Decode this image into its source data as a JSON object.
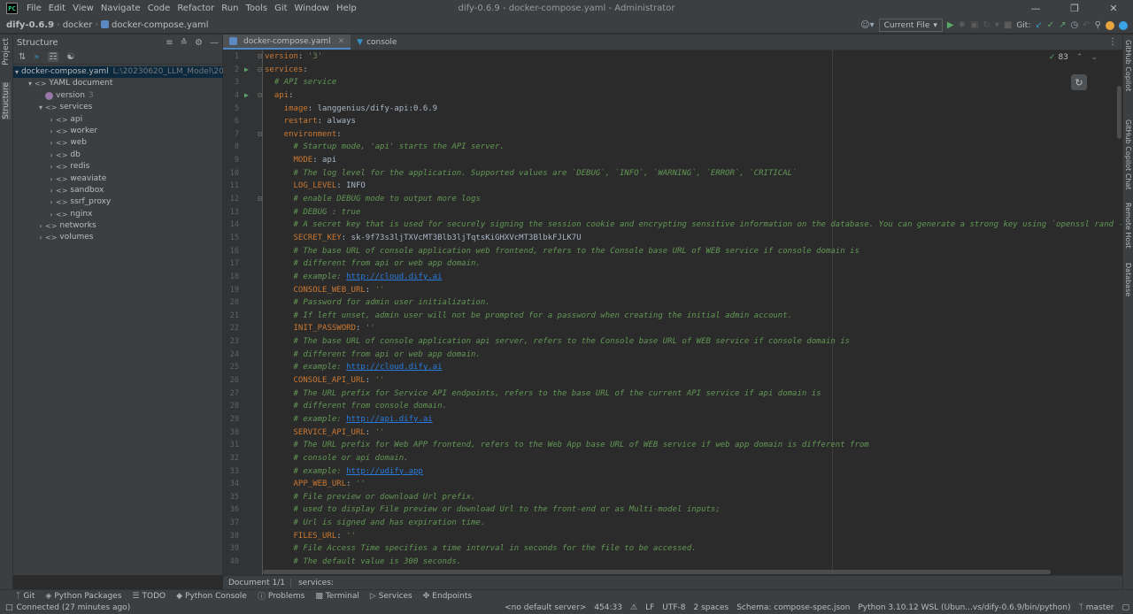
{
  "titlebar": {
    "menu": [
      "File",
      "Edit",
      "View",
      "Navigate",
      "Code",
      "Refactor",
      "Run",
      "Tools",
      "Git",
      "Window",
      "Help"
    ],
    "title": "dify-0.6.9 - docker-compose.yaml - Administrator"
  },
  "navbar": {
    "project": "dify-0.6.9",
    "folder": "docker",
    "file": "docker-compose.yaml",
    "run_config": "Current File",
    "git_label": "Git:"
  },
  "left_stripe": {
    "project_tab": "Project",
    "structure_tab": "Structure"
  },
  "structure": {
    "title": "Structure",
    "tree": [
      {
        "label": "docker-compose.yaml",
        "path": "L:\\20230620_LLM_Model\\2023"
      },
      {
        "label": "YAML document"
      },
      {
        "label": "version",
        "count": "3"
      },
      {
        "label": "services"
      },
      {
        "label": "api"
      },
      {
        "label": "worker"
      },
      {
        "label": "web"
      },
      {
        "label": "db"
      },
      {
        "label": "redis"
      },
      {
        "label": "weaviate"
      },
      {
        "label": "sandbox"
      },
      {
        "label": "ssrf_proxy"
      },
      {
        "label": "nginx"
      },
      {
        "label": "networks"
      },
      {
        "label": "volumes"
      }
    ]
  },
  "tabs": [
    {
      "label": "docker-compose.yaml"
    },
    {
      "label": "console"
    }
  ],
  "editor": {
    "inspection_count": "83",
    "lines": [
      {
        "n": "1",
        "parts": [
          [
            "k",
            "version"
          ],
          [
            "v",
            ": "
          ],
          [
            "s",
            "'3'"
          ]
        ]
      },
      {
        "n": "2",
        "parts": [
          [
            "k",
            "services"
          ],
          [
            "v",
            ":"
          ]
        ]
      },
      {
        "n": "3",
        "parts": [
          [
            "c",
            "  # API service"
          ]
        ]
      },
      {
        "n": "4",
        "parts": [
          [
            "v",
            "  "
          ],
          [
            "k",
            "api"
          ],
          [
            "v",
            ":"
          ]
        ]
      },
      {
        "n": "5",
        "parts": [
          [
            "v",
            "    "
          ],
          [
            "k",
            "image"
          ],
          [
            "v",
            ": langgenius/dify-api:0.6.9"
          ]
        ]
      },
      {
        "n": "6",
        "parts": [
          [
            "v",
            "    "
          ],
          [
            "k",
            "restart"
          ],
          [
            "v",
            ": always"
          ]
        ]
      },
      {
        "n": "7",
        "parts": [
          [
            "v",
            "    "
          ],
          [
            "k",
            "environment"
          ],
          [
            "v",
            ":"
          ]
        ]
      },
      {
        "n": "8",
        "parts": [
          [
            "c",
            "      # Startup mode, 'api' starts the API server."
          ]
        ]
      },
      {
        "n": "9",
        "parts": [
          [
            "v",
            "      "
          ],
          [
            "k",
            "MODE"
          ],
          [
            "v",
            ": api"
          ]
        ]
      },
      {
        "n": "10",
        "parts": [
          [
            "c",
            "      # The log level for the application. Supported values are `DEBUG`, `INFO`, `WARNING`, `ERROR`, `CRITICAL`"
          ]
        ]
      },
      {
        "n": "11",
        "parts": [
          [
            "v",
            "      "
          ],
          [
            "k",
            "LOG_LEVEL"
          ],
          [
            "v",
            ": INFO"
          ]
        ]
      },
      {
        "n": "12",
        "parts": [
          [
            "c",
            "      # enable DEBUG mode to output more logs"
          ]
        ]
      },
      {
        "n": "13",
        "parts": [
          [
            "c",
            "      # DEBUG : true"
          ]
        ]
      },
      {
        "n": "14",
        "parts": [
          [
            "c",
            "      # A secret key that is used for securely signing the session cookie and encrypting sensitive information on the database. You can generate a strong key using `openssl rand -ba"
          ]
        ]
      },
      {
        "n": "15",
        "parts": [
          [
            "v",
            "      "
          ],
          [
            "k",
            "SECRET_KEY"
          ],
          [
            "v",
            ": sk-9f73s3ljTXVcMT3Blb3ljTqtsKiGHXVcMT3BlbkFJLK7U"
          ]
        ]
      },
      {
        "n": "16",
        "parts": [
          [
            "c",
            "      # The base URL of console application web frontend, refers to the Console base URL of WEB service if console domain is"
          ]
        ]
      },
      {
        "n": "17",
        "parts": [
          [
            "c",
            "      # different from api or web app domain."
          ]
        ]
      },
      {
        "n": "18",
        "parts": [
          [
            "c",
            "      # example: "
          ],
          [
            "u",
            "http://cloud.dify.ai"
          ]
        ]
      },
      {
        "n": "19",
        "parts": [
          [
            "v",
            "      "
          ],
          [
            "k",
            "CONSOLE_WEB_URL"
          ],
          [
            "v",
            ": "
          ],
          [
            "s",
            "''"
          ]
        ]
      },
      {
        "n": "20",
        "parts": [
          [
            "c",
            "      # Password for admin user initialization."
          ]
        ]
      },
      {
        "n": "21",
        "parts": [
          [
            "c",
            "      # If left unset, admin user will not be prompted for a password when creating the initial admin account."
          ]
        ]
      },
      {
        "n": "22",
        "parts": [
          [
            "v",
            "      "
          ],
          [
            "k",
            "INIT_PASSWORD"
          ],
          [
            "v",
            ": "
          ],
          [
            "s",
            "''"
          ]
        ]
      },
      {
        "n": "23",
        "parts": [
          [
            "c",
            "      # The base URL of console application api server, refers to the Console base URL of WEB service if console domain is"
          ]
        ]
      },
      {
        "n": "24",
        "parts": [
          [
            "c",
            "      # different from api or web app domain."
          ]
        ]
      },
      {
        "n": "25",
        "parts": [
          [
            "c",
            "      # example: "
          ],
          [
            "u",
            "http://cloud.dify.ai"
          ]
        ]
      },
      {
        "n": "26",
        "parts": [
          [
            "v",
            "      "
          ],
          [
            "k",
            "CONSOLE_API_URL"
          ],
          [
            "v",
            ": "
          ],
          [
            "s",
            "''"
          ]
        ]
      },
      {
        "n": "27",
        "parts": [
          [
            "c",
            "      # The URL prefix for Service API endpoints, refers to the base URL of the current API service if api domain is"
          ]
        ]
      },
      {
        "n": "28",
        "parts": [
          [
            "c",
            "      # different from console domain."
          ]
        ]
      },
      {
        "n": "29",
        "parts": [
          [
            "c",
            "      # example: "
          ],
          [
            "u",
            "http://api.dify.ai"
          ]
        ]
      },
      {
        "n": "30",
        "parts": [
          [
            "v",
            "      "
          ],
          [
            "k",
            "SERVICE_API_URL"
          ],
          [
            "v",
            ": "
          ],
          [
            "s",
            "''"
          ]
        ]
      },
      {
        "n": "31",
        "parts": [
          [
            "c",
            "      # The URL prefix for Web APP frontend, refers to the Web App base URL of WEB service if web app domain is different from"
          ]
        ]
      },
      {
        "n": "32",
        "parts": [
          [
            "c",
            "      # console or api domain."
          ]
        ]
      },
      {
        "n": "33",
        "parts": [
          [
            "c",
            "      # example: "
          ],
          [
            "u",
            "http://udify.app"
          ]
        ]
      },
      {
        "n": "34",
        "parts": [
          [
            "v",
            "      "
          ],
          [
            "k",
            "APP_WEB_URL"
          ],
          [
            "v",
            ": "
          ],
          [
            "s",
            "''"
          ]
        ]
      },
      {
        "n": "35",
        "parts": [
          [
            "c",
            "      # File preview or download Url prefix."
          ]
        ]
      },
      {
        "n": "36",
        "parts": [
          [
            "c",
            "      # used to display File preview or download Url to the front-end or as Multi-model inputs;"
          ]
        ]
      },
      {
        "n": "37",
        "parts": [
          [
            "c",
            "      # Url is signed and has expiration time."
          ]
        ]
      },
      {
        "n": "38",
        "parts": [
          [
            "v",
            "      "
          ],
          [
            "k",
            "FILES_URL"
          ],
          [
            "v",
            ": "
          ],
          [
            "s",
            "''"
          ]
        ]
      },
      {
        "n": "39",
        "parts": [
          [
            "c",
            "      # File Access Time specifies a time interval in seconds for the file to be accessed."
          ]
        ]
      },
      {
        "n": "40",
        "parts": [
          [
            "c",
            "      # The default value is 300 seconds."
          ]
        ]
      }
    ]
  },
  "docbar": {
    "document": "Document 1/1",
    "path": "services:"
  },
  "right_stripe": [
    "GitHub Copilot",
    "GitHub Copilot Chat",
    "Remote Host",
    "Database"
  ],
  "tool_windows": [
    "Git",
    "Python Packages",
    "TODO",
    "Python Console",
    "Problems",
    "Terminal",
    "Services",
    "Endpoints"
  ],
  "status": {
    "message": "Connected (27 minutes ago)",
    "interpreter_config": "<no default server>",
    "position": "454:33",
    "line_sep": "LF",
    "encoding": "UTF-8",
    "indent": "2 spaces",
    "schema": "Schema: compose-spec.json",
    "python": "Python 3.10.12 WSL (Ubun...vs/dify-0.6.9/bin/python)",
    "branch": "master"
  }
}
